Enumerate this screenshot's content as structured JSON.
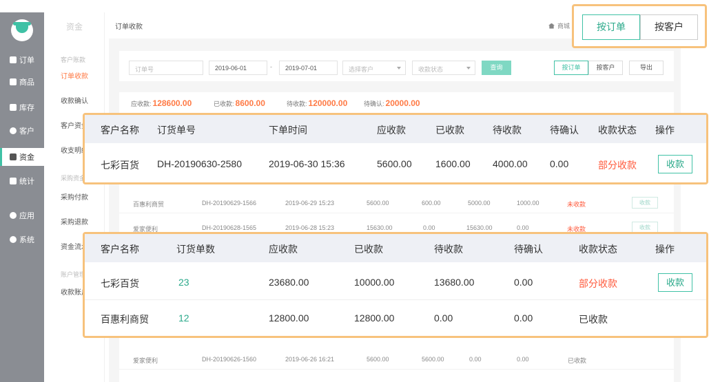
{
  "nav": {
    "items": [
      {
        "label": "订单",
        "icon": "clipboard-icon"
      },
      {
        "label": "商品",
        "icon": "envelope-icon"
      },
      {
        "label": "库存",
        "icon": "warehouse-icon"
      },
      {
        "label": "客户",
        "icon": "person-icon"
      },
      {
        "label": "资金",
        "icon": "fund-icon"
      },
      {
        "label": "统计",
        "icon": "bar-chart-icon"
      },
      {
        "label": "应用",
        "icon": "apps-icon"
      },
      {
        "label": "系统",
        "icon": "gear-icon"
      }
    ]
  },
  "subnav": {
    "title": "资金",
    "groups": [
      "客户账款",
      "采购资金",
      "账户管理"
    ],
    "items": [
      "订单收款",
      "收款确认",
      "客户资金",
      "收支明细",
      "采购付款",
      "采购退款",
      "资金流水",
      "收款账户"
    ]
  },
  "breadcrumb": "订单收款",
  "home_label": "商城",
  "filter": {
    "order_no_placeholder": "订单号",
    "date_from": "2019-06-01",
    "date_sep": "-",
    "date_to": "2019-07-01",
    "customer_placeholder": "选择客户",
    "status_placeholder": "收款状态",
    "query_label": "查询",
    "by_order_label": "按订单",
    "by_customer_label": "按客户",
    "export_label": "导出"
  },
  "summary": {
    "receivable_label": "应收款:",
    "receivable_value": "128600.00",
    "received_label": "已收款:",
    "received_value": "8600.00",
    "pending_label": "待收款:",
    "pending_value": "120000.00",
    "confirm_label": "待确认:",
    "confirm_value": "20000.00"
  },
  "background_rows": [
    {
      "customer": "百惠利商贸",
      "order_no": "DH-20190629-1566",
      "time": "2019-06-29 15:23",
      "receivable": "5600.00",
      "received": "600.00",
      "pending": "5000.00",
      "confirm": "1000.00",
      "status": "未收款",
      "action": "收款"
    },
    {
      "customer": "爱家便利",
      "order_no": "DH-20190628-1565",
      "time": "2019-06-28 15:23",
      "receivable": "15630.00",
      "received": "0.00",
      "pending": "15630.00",
      "confirm": "0.00",
      "status": "未收款",
      "action": "收款"
    },
    {
      "customer": "爱家便利",
      "order_no": "DH-20190626-1560",
      "time": "2019-06-26 16:21",
      "receivable": "5600.00",
      "received": "5600.00",
      "pending": "0.00",
      "confirm": "0.00",
      "status": "已收款"
    }
  ],
  "toggle_callout": {
    "by_order": "按订单",
    "by_customer": "按客户"
  },
  "order_table": {
    "headers": [
      "客户名称",
      "订货单号",
      "下单时间",
      "应收款",
      "已收款",
      "待收款",
      "待确认",
      "收款状态",
      "操作"
    ],
    "rows": [
      {
        "customer": "七彩百货",
        "order_no": "DH-20190630-2580",
        "time": "2019-06-30 15:36",
        "receivable": "5600.00",
        "received": "1600.00",
        "pending": "4000.00",
        "confirm": "0.00",
        "status": "部分收款",
        "action": "收款"
      }
    ]
  },
  "customer_table": {
    "headers": [
      "客户名称",
      "订货单数",
      "应收款",
      "已收款",
      "待收款",
      "待确认",
      "收款状态",
      "操作"
    ],
    "rows": [
      {
        "customer": "七彩百货",
        "count": "23",
        "receivable": "23680.00",
        "received": "10000.00",
        "pending": "13680.00",
        "confirm": "0.00",
        "status": "部分收款",
        "action": "收款"
      },
      {
        "customer": "百惠利商贸",
        "count": "12",
        "receivable": "12800.00",
        "received": "12800.00",
        "pending": "0.00",
        "confirm": "0.00",
        "status": "已收款"
      }
    ]
  },
  "colors": {
    "accent": "#3fc1a5",
    "warn": "#ff5a3c",
    "highlight": "#f7c27c"
  }
}
